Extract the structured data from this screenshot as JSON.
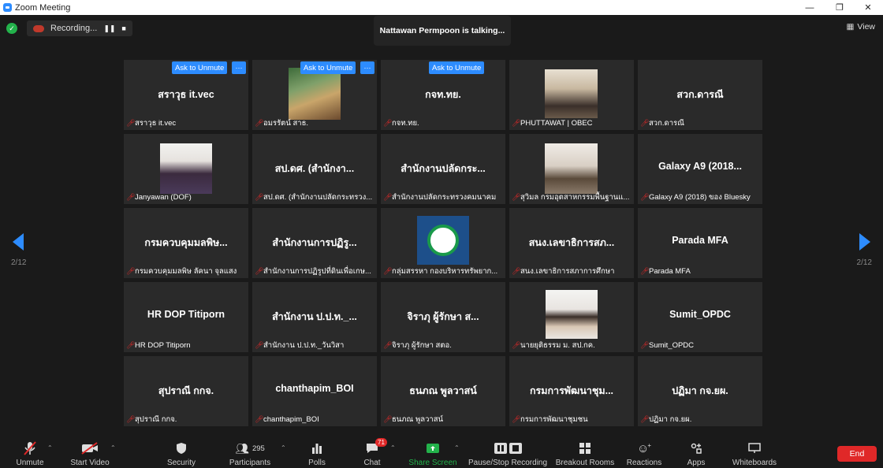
{
  "window": {
    "title": "Zoom Meeting"
  },
  "recording": {
    "label": "Recording..."
  },
  "talking": "Nattawan Permpoon is talking...",
  "view_label": "View",
  "pages": {
    "left": "2/12",
    "right": "2/12"
  },
  "ask_unmute": "Ask to Unmute",
  "more": "···",
  "tiles": [
    {
      "big": "สราวุธ it.vec",
      "small": "สราวุธ it.vec"
    },
    {
      "big": "",
      "small": "อมรรัตน์ สาธ."
    },
    {
      "big": "กจท.ทย.",
      "small": "กจท.ทย."
    },
    {
      "big": "",
      "small": "PHUTTAWAT | OBEC"
    },
    {
      "big": "สวก.ดารณี",
      "small": "สวก.ดารณี"
    },
    {
      "big": "",
      "small": "Janyawan (DOF)"
    },
    {
      "big": "สป.ดศ. (สำนักงา...",
      "small": "สป.ดศ. (สำนักงานปลัดกระทรวง..."
    },
    {
      "big": "สำนักงานปลัดกระ...",
      "small": "สำนักงานปลัดกระทรวงคมนาคม"
    },
    {
      "big": "",
      "small": "สุวิมล กรมอุตสาหกรรมพื้นฐานแ..."
    },
    {
      "big": "Galaxy A9 (2018...",
      "small": "Galaxy A9 (2018) ของ Bluesky"
    },
    {
      "big": "กรมควบคุมมลพิษ...",
      "small": "กรมควบคุมมลพิษ ลัคนา จุลแสง"
    },
    {
      "big": "สำนักงานการปฏิรู...",
      "small": "สำนักงานการปฏิรูปที่ดินเพื่อเกษ..."
    },
    {
      "big": "",
      "small": "กลุ่มสรรหา กองบริหารทรัพยาก..."
    },
    {
      "big": "สนง.เลขาธิการสภ...",
      "small": "สนง.เลขาธิการสภาการศึกษา"
    },
    {
      "big": "Parada MFA",
      "small": "Parada MFA"
    },
    {
      "big": "HR DOP Titiporn",
      "small": "HR DOP Titiporn"
    },
    {
      "big": "สำนักงาน ป.ป.ท._...",
      "small": "สำนักงาน ป.ป.ท._วันวิสา"
    },
    {
      "big": "จิราภุ  ผู้รักษา   ส...",
      "small": "จิราภุ  ผู้รักษา   สตอ."
    },
    {
      "big": "",
      "small": "นายยุติธรรม ม. สป.กค."
    },
    {
      "big": "Sumit_OPDC",
      "small": "Sumit_OPDC"
    },
    {
      "big": "สุปราณี กกจ.",
      "small": "สุปราณี กกจ."
    },
    {
      "big": "chanthapim_BOI",
      "small": "chanthapim_BOI"
    },
    {
      "big": "ธนภณ พูลวาสน์",
      "small": "ธนภณ พูลวาสน์"
    },
    {
      "big": "กรมการพัฒนาชุม...",
      "small": "กรมการพัฒนาชุมชน"
    },
    {
      "big": "ปฏิมา กจ.ยผ.",
      "small": "ปฏิมา กจ.ยผ."
    }
  ],
  "toolbar": {
    "unmute": "Unmute",
    "start_video": "Start Video",
    "security": "Security",
    "participants": "Participants",
    "participants_count": "295",
    "polls": "Polls",
    "chat": "Chat",
    "chat_badge": "71",
    "share_screen": "Share Screen",
    "pause_stop": "Pause/Stop Recording",
    "breakout": "Breakout Rooms",
    "reactions": "Reactions",
    "apps": "Apps",
    "whiteboards": "Whiteboards",
    "end": "End"
  },
  "colors": {
    "accent": "#2d8cff",
    "end": "#e02828",
    "share": "#23b24b"
  }
}
